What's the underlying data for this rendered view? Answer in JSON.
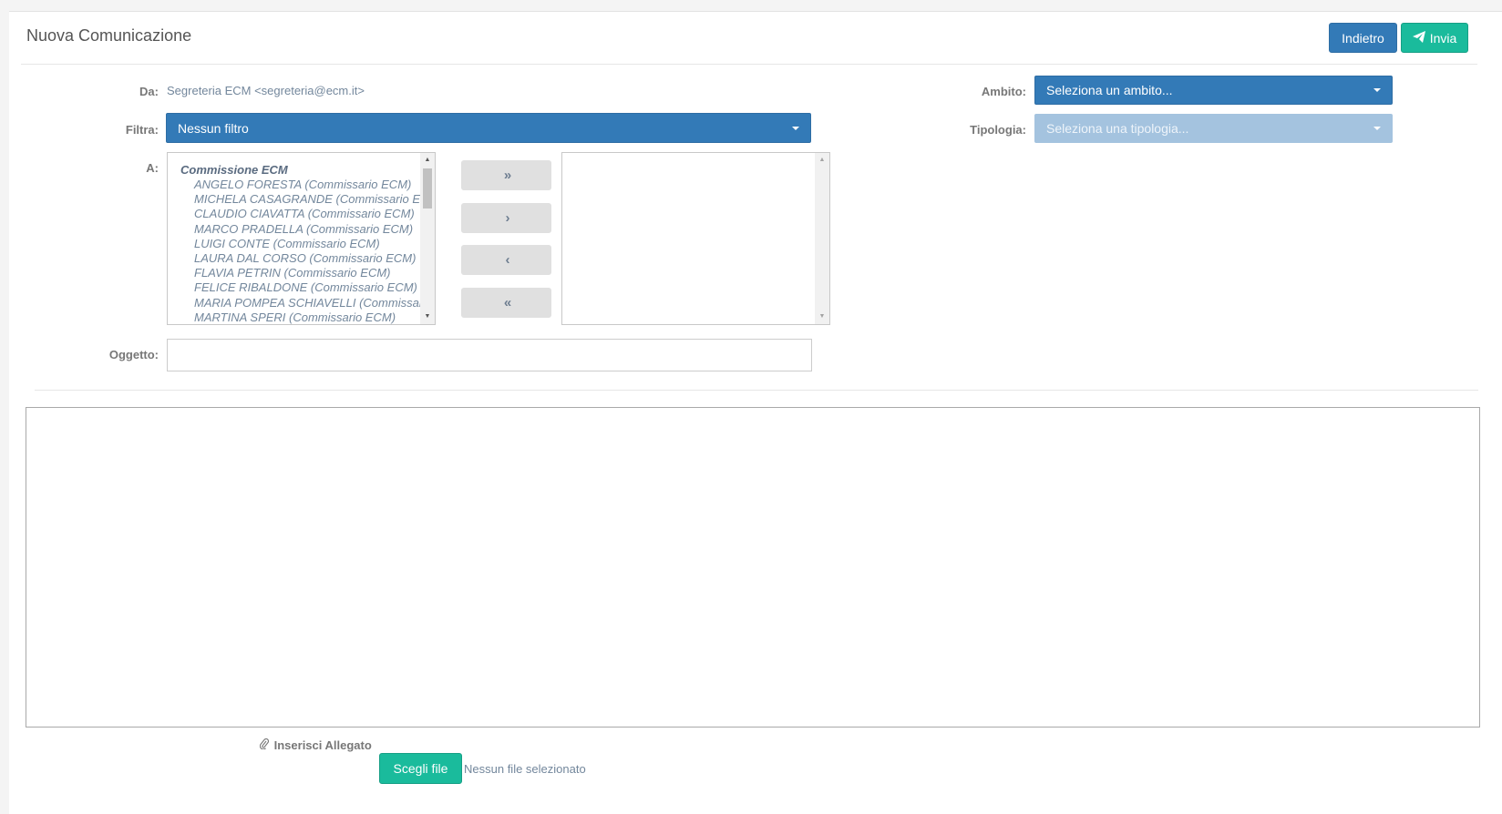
{
  "header": {
    "title": "Nuova Comunicazione",
    "back_label": "Indietro",
    "send_label": "Invia"
  },
  "form": {
    "from_label": "Da:",
    "from_value": "Segreteria ECM <segreteria@ecm.it>",
    "filter_label": "Filtra:",
    "filter_value": "Nessun filtro",
    "to_label": "A:",
    "subject_label": "Oggetto:",
    "subject_value": "",
    "scope_label": "Ambito:",
    "scope_value": "Seleziona un ambito...",
    "type_label": "Tipologia:",
    "type_value": "Seleziona una tipologia..."
  },
  "recipients": {
    "group": "Commissione ECM",
    "options": [
      "ANGELO FORESTA (Commissario ECM)",
      "MICHELA CASAGRANDE (Commissario ECM)",
      "CLAUDIO CIAVATTA (Commissario ECM)",
      "MARCO PRADELLA (Commissario ECM)",
      "LUIGI CONTE (Commissario ECM)",
      "LAURA DAL CORSO (Commissario ECM)",
      "FLAVIA PETRIN (Commissario ECM)",
      "FELICE RIBALDONE (Commissario ECM)",
      "MARIA POMPEA SCHIAVELLI (Commissario ECM)",
      "MARTINA SPERI (Commissario ECM)"
    ],
    "move_buttons": {
      "all_right": "»",
      "right": "›",
      "left": "‹",
      "all_left": "«"
    }
  },
  "attachment": {
    "label": "Inserisci Allegato",
    "clip_icon": "📎",
    "button_label": "Scegli file",
    "status": "Nessun file selezionato"
  },
  "icons": {
    "send": "paper-plane-icon",
    "clip": "paperclip-icon"
  },
  "colors": {
    "primary": "#337ab7",
    "success": "#1abb9c",
    "disabled": "#a4c3df"
  }
}
